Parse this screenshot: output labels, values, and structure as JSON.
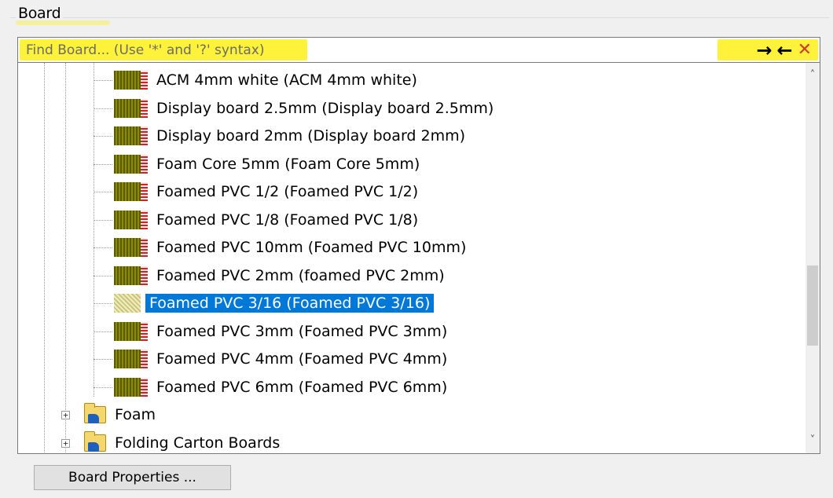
{
  "group": {
    "label": "Board"
  },
  "search": {
    "placeholder": "Find Board... (Use '*' and '?' syntax)",
    "value": ""
  },
  "find_actions": {
    "next": "→",
    "prev": "←",
    "clear": "✕"
  },
  "tree": {
    "boards": [
      {
        "label": "ACM 4mm white (ACM 4mm white)",
        "selected": false
      },
      {
        "label": "Display board 2.5mm (Display board 2.5mm)",
        "selected": false
      },
      {
        "label": "Display board 2mm (Display board 2mm)",
        "selected": false
      },
      {
        "label": "Foam Core 5mm (Foam Core 5mm)",
        "selected": false
      },
      {
        "label": "Foamed PVC 1/2 (Foamed PVC 1/2)",
        "selected": false
      },
      {
        "label": "Foamed PVC 1/8 (Foamed PVC 1/8)",
        "selected": false
      },
      {
        "label": "Foamed PVC 10mm (Foamed PVC 10mm)",
        "selected": false
      },
      {
        "label": "Foamed PVC 2mm (foamed PVC 2mm)",
        "selected": false
      },
      {
        "label": "Foamed PVC 3/16 (Foamed PVC 3/16)",
        "selected": true
      },
      {
        "label": "Foamed PVC 3mm (Foamed PVC 3mm)",
        "selected": false
      },
      {
        "label": "Foamed PVC 4mm (Foamed PVC 4mm)",
        "selected": false
      },
      {
        "label": "Foamed PVC 6mm (Foamed PVC 6mm)",
        "selected": false
      }
    ],
    "folders": [
      {
        "label": "Foam",
        "expander": "+"
      },
      {
        "label": "Folding Carton Boards",
        "expander": "+"
      }
    ]
  },
  "scrollbar": {
    "up": "˄",
    "down": "˅"
  },
  "footer": {
    "properties_button": "Board Properties ..."
  },
  "colors": {
    "highlight": "#fff23a",
    "selection": "#0078d7",
    "clear_icon": "#d23a2a"
  }
}
